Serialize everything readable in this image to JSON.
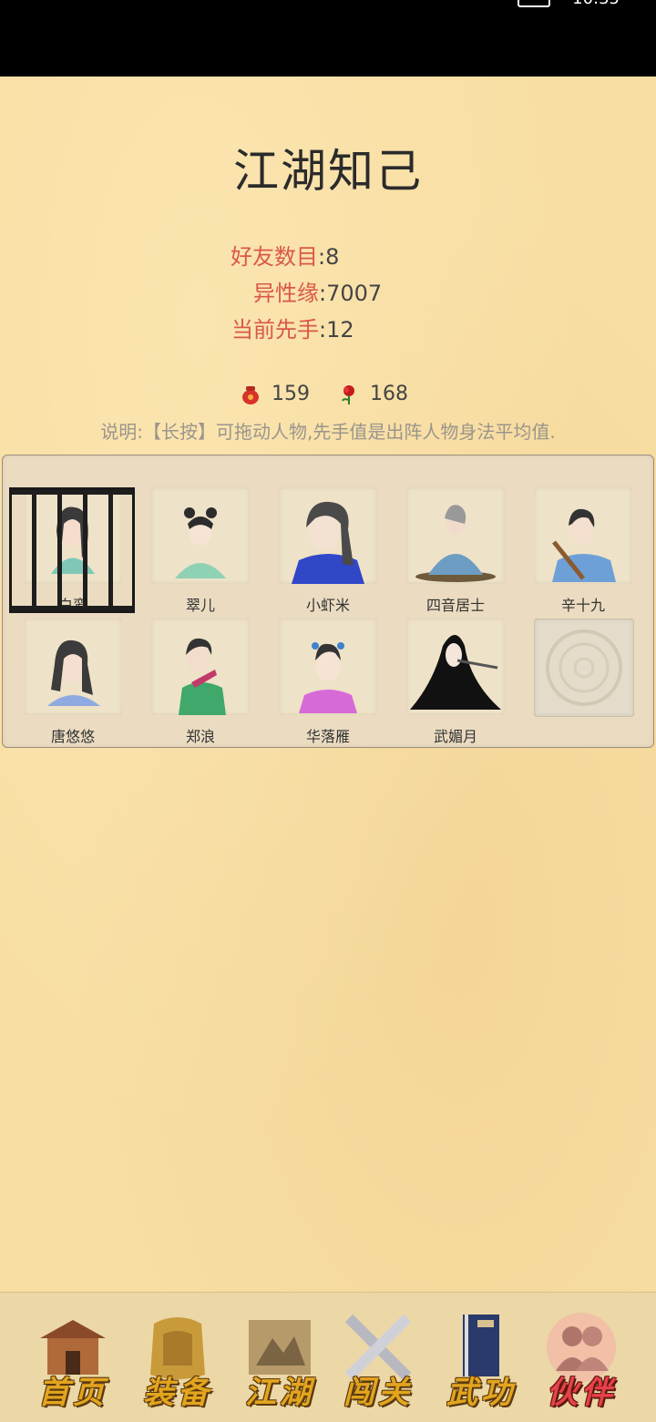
{
  "status": {
    "left": "",
    "right": "10:35"
  },
  "title": "江湖知己",
  "stats": [
    {
      "label": "好友数目",
      "sep": ":",
      "value": "8"
    },
    {
      "label": "异性缘",
      "sep": ":",
      "value": "7007"
    },
    {
      "label": "当前先手",
      "sep": ":",
      "value": "12"
    }
  ],
  "resources": [
    {
      "icon": "red-pouch-icon",
      "value": "159"
    },
    {
      "icon": "rose-icon",
      "value": "168"
    }
  ],
  "note": "说明:【长按】可拖动人物,先手值是出阵人物身法平均值.",
  "characters": [
    {
      "name": "白鸾",
      "locked": true
    },
    {
      "name": "翠儿"
    },
    {
      "name": "小虾米"
    },
    {
      "name": "四音居士"
    },
    {
      "name": "辛十九"
    },
    {
      "name": "唐悠悠"
    },
    {
      "name": "郑浪"
    },
    {
      "name": "华落雁"
    },
    {
      "name": "武媚月"
    },
    {
      "name": ""
    }
  ],
  "nav": [
    {
      "label": "首页",
      "icon": "house-icon"
    },
    {
      "label": "装备",
      "icon": "armor-icon"
    },
    {
      "label": "江湖",
      "icon": "scroll-map-icon"
    },
    {
      "label": "闯关",
      "icon": "crossed-swords-icon"
    },
    {
      "label": "武功",
      "icon": "book-icon"
    },
    {
      "label": "伙伴",
      "icon": "companions-icon",
      "active": true
    }
  ],
  "colors": {
    "label_red": "#d9584a",
    "bg": "#f8dea2",
    "nav_gold": "#e3a51e",
    "nav_active": "#e8404a"
  }
}
